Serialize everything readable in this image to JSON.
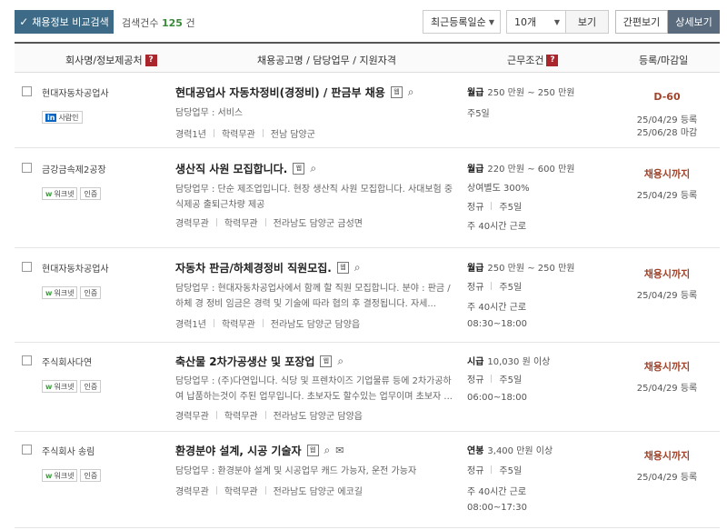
{
  "toolbar": {
    "compare_label": "채용정보 비교검색",
    "count_label": "검색건수",
    "count_value": "125",
    "count_unit": "건",
    "sort_selected": "최근등록일순",
    "per_page_selected": "10개",
    "view_label": "보기",
    "simple_view_label": "간편보기",
    "detail_view_label": "상세보기"
  },
  "header": {
    "company": "회사명/정보제공처",
    "posting": "채용공고명 / 담당업무 / 지원자격",
    "conditions": "근무조건",
    "deadline": "등록/마감일",
    "help": "?"
  },
  "rows": [
    {
      "company": "현대자동차공업사",
      "badges": [
        {
          "type": "linkedin",
          "icon": "in",
          "label": "사람인"
        }
      ],
      "title": "현대공업사 자동차정비(경정비) / 판금부 채용",
      "title_icon": "웹",
      "desc": "담당업무 : 서비스",
      "meta": [
        "경력1년",
        "학력무관",
        "전남 담양군"
      ],
      "conditions": [
        {
          "strong": "월급",
          "text": "250 만원 ~ 250 만원"
        },
        {
          "text": "주5일"
        }
      ],
      "status": "D-60",
      "dates": [
        "25/04/29 등록",
        "25/06/28 마감"
      ]
    },
    {
      "company": "금강금속제2공장",
      "badges": [
        {
          "type": "worknet",
          "icon": "w",
          "label": "워크넷"
        },
        {
          "type": "cert",
          "label": "인증"
        }
      ],
      "title": "생산직 사원 모집합니다.",
      "title_icon": "웹",
      "desc": "담당업무 : 단순 제조업입니다. 현장 생산직 사원 모집합니다. 사대보험 중식제공 출퇴근차량 제공",
      "meta": [
        "경력무관",
        "학력무관",
        "전라남도 담양군 금성면"
      ],
      "conditions": [
        {
          "strong": "월급",
          "text": "220 만원 ~ 600 만원"
        },
        {
          "text": "상여별도 300%"
        },
        {
          "items": [
            "정규",
            "주5일"
          ]
        },
        {
          "text": "주 40시간 근로"
        }
      ],
      "status": "채용시까지",
      "dates": [
        "25/04/29 등록"
      ]
    },
    {
      "company": "현대자동차공업사",
      "badges": [
        {
          "type": "worknet",
          "icon": "w",
          "label": "워크넷"
        },
        {
          "type": "cert",
          "label": "인증"
        }
      ],
      "title": "자동차 판금/하체경정비 직원모집.",
      "title_icon": "웹",
      "desc": "담당업무 : 현대자동차공업사에서 함께 할 직원 모집합니다. 분야 : 판금 / 하체 경 정비 임금은 경력 및 기술에 따라 협의 후 결정됩니다. 자세...",
      "meta": [
        "경력1년",
        "학력무관",
        "전라남도 담양군 담양읍"
      ],
      "conditions": [
        {
          "strong": "월급",
          "text": "250 만원 ~ 250 만원"
        },
        {
          "items": [
            "정규",
            "주5일"
          ]
        },
        {
          "text": "주 40시간 근로"
        },
        {
          "text": "08:30~18:00"
        }
      ],
      "status": "채용시까지",
      "dates": [
        "25/04/29 등록"
      ]
    },
    {
      "company": "주식회사다연",
      "badges": [
        {
          "type": "worknet",
          "icon": "w",
          "label": "워크넷"
        },
        {
          "type": "cert",
          "label": "인증"
        }
      ],
      "title": "축산물 2차가공생산 및 포장업",
      "title_icon": "웹",
      "desc": "담당업무 : (주)다연입니다. 식당 및 프렌차이즈 기업물류 등에 2차가공하여 납품하는것이 주된 업무입니다. 초보자도 할수있는 업무이며 초보자 ...",
      "meta": [
        "경력무관",
        "학력무관",
        "전라남도 담양군 담양읍"
      ],
      "conditions": [
        {
          "strong": "시급",
          "text": "10,030 원 이상"
        },
        {
          "items": [
            "정규",
            "주5일"
          ]
        },
        {
          "text": "06:00~18:00"
        }
      ],
      "status": "채용시까지",
      "dates": [
        "25/04/29 등록"
      ]
    },
    {
      "company": "주식회사 송림",
      "badges": [
        {
          "type": "worknet",
          "icon": "w",
          "label": "워크넷"
        },
        {
          "type": "cert",
          "label": "인증"
        }
      ],
      "title": "환경분야 설계, 시공 기술자",
      "title_icon": "웹",
      "desc": "담당업무 : 환경분야 설계 및 시공업무 캐드 가능자, 운전 가능자",
      "meta": [
        "경력무관",
        "학력무관",
        "전라남도 담양군 에코길"
      ],
      "conditions": [
        {
          "strong": "연봉",
          "text": "3,400 만원 이상"
        },
        {
          "items": [
            "정규",
            "주5일"
          ]
        },
        {
          "text": "주 40시간 근로"
        },
        {
          "text": "08:00~17:30"
        }
      ],
      "status": "채용시까지",
      "dates": [
        "25/04/29 등록"
      ]
    }
  ]
}
